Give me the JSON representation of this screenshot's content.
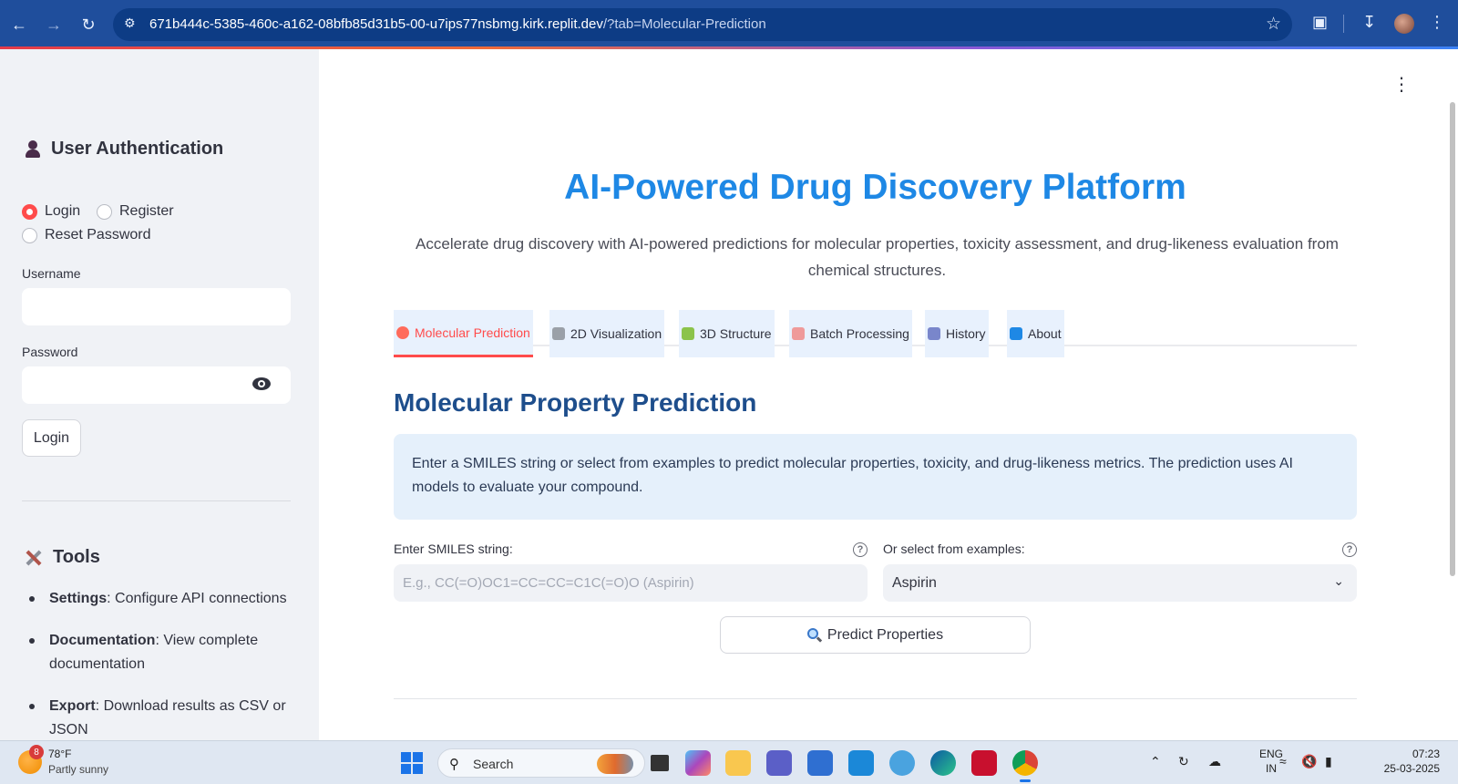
{
  "browser": {
    "url_host": "671b444c-5385-460c-a162-08bfb85d31b5-00-u7ips77nsbmg.kirk.replit.dev",
    "url_path": "/?tab=Molecular-Prediction"
  },
  "sidebar": {
    "auth_title": "User Authentication",
    "auth_options": [
      "Login",
      "Register",
      "Reset Password"
    ],
    "selected_option": "Login",
    "username_label": "Username",
    "password_label": "Password",
    "login_button": "Login",
    "tools_title": "Tools",
    "tools": [
      {
        "name": "Settings",
        "desc": ": Configure API connections"
      },
      {
        "name": "Documentation",
        "desc": ": View complete documentation"
      },
      {
        "name": "Export",
        "desc": ": Download results as CSV or JSON"
      }
    ]
  },
  "main": {
    "title": "AI-Powered Drug Discovery Platform",
    "subtitle": "Accelerate drug discovery with AI-powered predictions for molecular properties, toxicity assessment, and drug-likeness evaluation from chemical structures.",
    "tabs": [
      {
        "label": "Molecular Prediction",
        "icon": "pill-icon",
        "color": "#ff4b4b"
      },
      {
        "label": "2D Visualization",
        "icon": "microscope-icon",
        "color": "#7a7f8a"
      },
      {
        "label": "3D Structure",
        "icon": "test-tube-icon",
        "color": "#7cb342"
      },
      {
        "label": "Batch Processing",
        "icon": "calendar-icon",
        "color": "#e57373"
      },
      {
        "label": "History",
        "icon": "bar-chart-icon",
        "color": "#5c6bc0"
      },
      {
        "label": "About",
        "icon": "info-icon",
        "color": "#1e88e5"
      }
    ],
    "active_tab": "Molecular Prediction",
    "section_title": "Molecular Property Prediction",
    "info_text": "Enter a SMILES string or select from examples to predict molecular properties, toxicity, and drug-likeness metrics. The prediction uses AI models to evaluate your compound.",
    "smiles_label": "Enter SMILES string:",
    "smiles_placeholder": "E.g., CC(=O)OC1=CC=CC=C1C(=O)O (Aspirin)",
    "examples_label": "Or select from examples:",
    "examples_selected": "Aspirin",
    "predict_button": "Predict Properties"
  },
  "taskbar": {
    "weather_badge": "8",
    "weather_temp": "78°F",
    "weather_desc": "Partly sunny",
    "search_text": "Search",
    "lang_line1": "ENG",
    "lang_line2": "IN",
    "time": "07:23",
    "date": "25-03-2025"
  },
  "colors": {
    "accent": "#ff4b4b",
    "title_blue": "#1e88e5",
    "section_blue": "#1e4e8c",
    "info_bg": "#e5f0fb"
  }
}
